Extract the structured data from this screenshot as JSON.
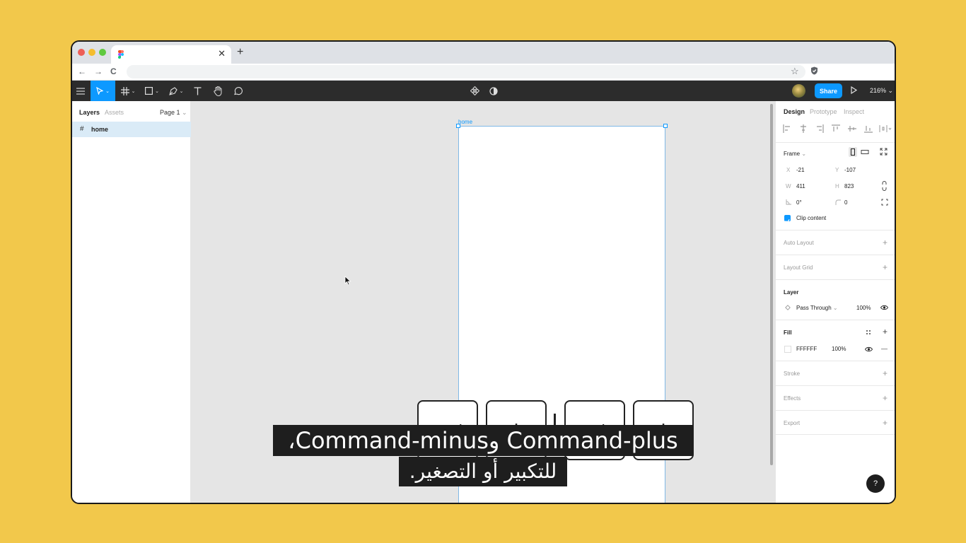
{
  "browser": {
    "tab": {
      "title": "",
      "close_glyph": "✕"
    },
    "new_tab_glyph": "+",
    "nav": {
      "back": "←",
      "forward": "→",
      "reload": "C"
    },
    "url": "",
    "star_glyph": "☆"
  },
  "toolbar": {
    "share_label": "Share",
    "zoom_label": "216%",
    "caret": "⌄"
  },
  "left_panel": {
    "tabs": [
      "Layers",
      "Assets"
    ],
    "page_label": "Page 1",
    "layers": [
      {
        "icon": "#",
        "name": "home"
      }
    ]
  },
  "canvas": {
    "frame_label": "home",
    "keys": [
      "cmd",
      "+",
      "ctrl",
      "+"
    ]
  },
  "right_panel": {
    "tabs": [
      "Design",
      "Prototype",
      "Inspect"
    ],
    "frame_label": "Frame",
    "x_label": "X",
    "x_value": "-21",
    "y_label": "Y",
    "y_value": "-107",
    "w_label": "W",
    "w_value": "411",
    "h_label": "H",
    "h_value": "823",
    "rotation": "0°",
    "radius": "0",
    "clip_content": "Clip content",
    "auto_layout": "Auto Layout",
    "layout_grid": "Layout Grid",
    "layer_title": "Layer",
    "blend_mode": "Pass Through",
    "layer_opacity": "100%",
    "fill_title": "Fill",
    "fill_hex": "FFFFFF",
    "fill_opacity": "100%",
    "stroke": "Stroke",
    "effects": "Effects",
    "export": "Export",
    "plus": "+",
    "minus": "—",
    "help": "?"
  },
  "subtitles": {
    "line1": "Command-plus وCommand-minus،",
    "line2": "للتكبير أو التصغير."
  },
  "colors": {
    "background": "#F2C84B",
    "accent": "#0D99FF",
    "toolbar": "#2C2C2C"
  }
}
